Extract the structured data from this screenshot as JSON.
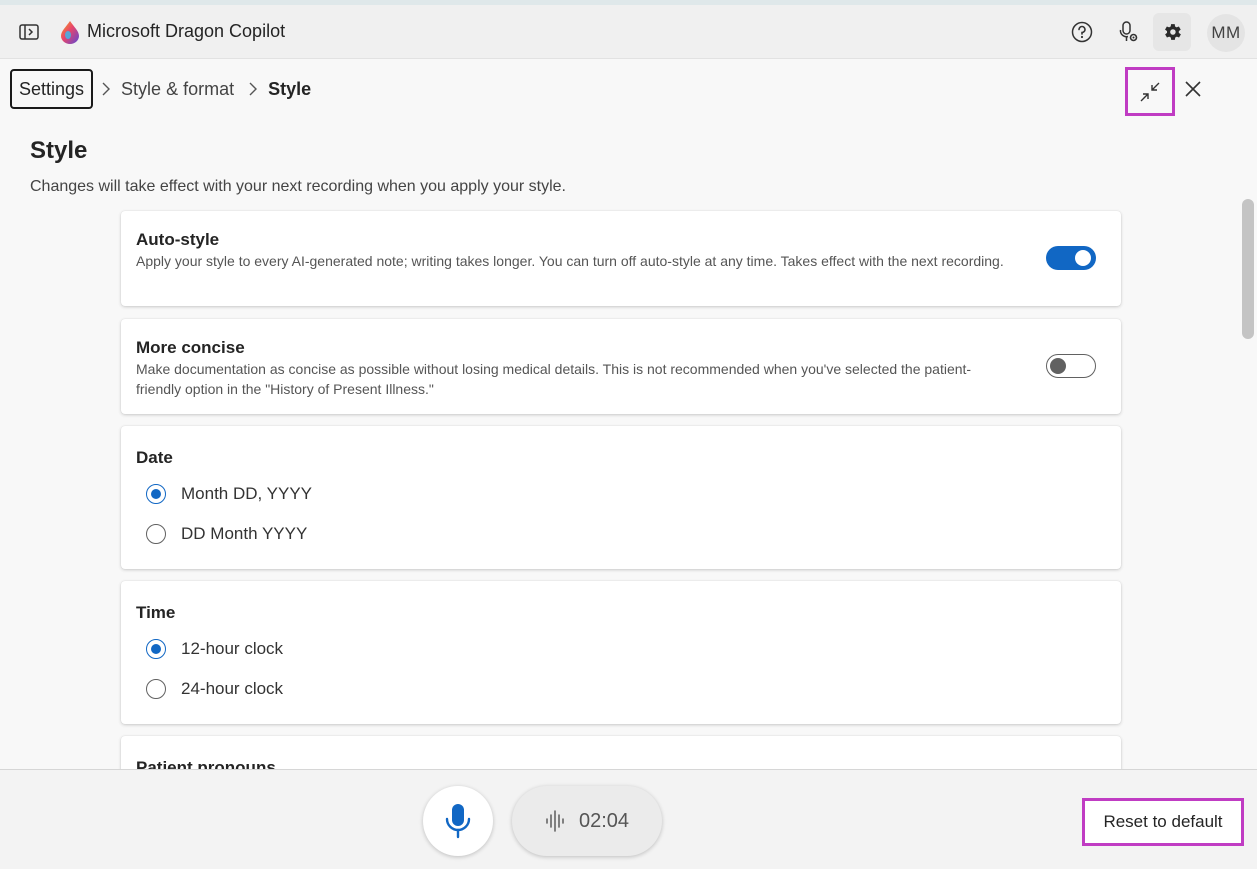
{
  "app": {
    "title": "Microsoft Dragon Copilot",
    "user_initials": "MM"
  },
  "breadcrumb": {
    "items": [
      "Settings",
      "Style & format",
      "Style"
    ]
  },
  "page": {
    "title": "Style",
    "subtitle": "Changes will take effect with your next recording when you apply your style."
  },
  "settings": {
    "auto_style": {
      "title": "Auto-style",
      "description": "Apply your style to every AI-generated note; writing takes longer. You can turn off auto-style at any time. Takes effect with the next recording.",
      "enabled": true
    },
    "more_concise": {
      "title": "More concise",
      "description": "Make documentation as concise as possible without losing medical details. This is not recommended when you've selected the patient-friendly option in the \"History of Present Illness.\"",
      "enabled": false
    },
    "date": {
      "title": "Date",
      "options": [
        {
          "label": "Month DD, YYYY",
          "selected": true
        },
        {
          "label": "DD Month YYYY",
          "selected": false
        }
      ]
    },
    "time": {
      "title": "Time",
      "options": [
        {
          "label": "12-hour clock",
          "selected": true
        },
        {
          "label": "24-hour clock",
          "selected": false
        }
      ]
    },
    "patient_pronouns": {
      "title": "Patient pronouns"
    }
  },
  "bottom_bar": {
    "timer": "02:04",
    "reset_label": "Reset to default"
  },
  "colors": {
    "accent": "#1167c4",
    "highlight": "#c03cc3"
  }
}
